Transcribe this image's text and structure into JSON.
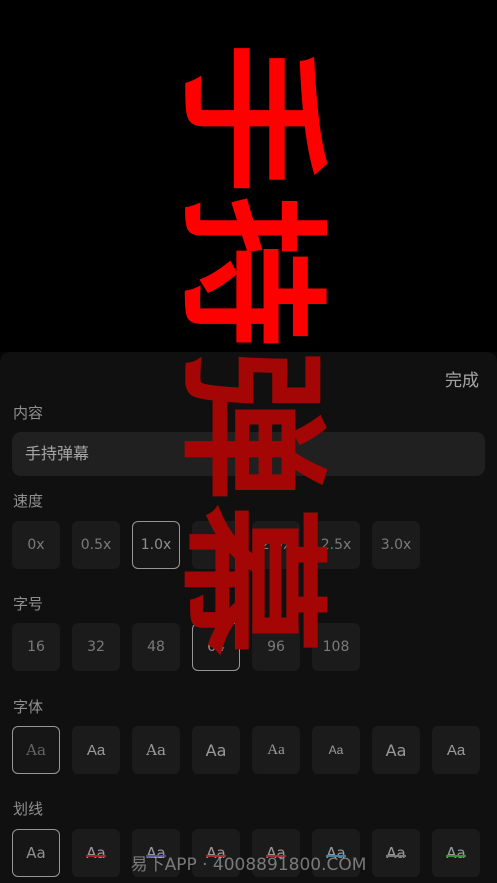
{
  "banner": {
    "chars": [
      "手",
      "持",
      "弹",
      "幕"
    ],
    "color": "#ff0000"
  },
  "header": {
    "done_label": "完成"
  },
  "content": {
    "label": "内容",
    "value": "手持弹幕"
  },
  "speed": {
    "label": "速度",
    "options": [
      "0x",
      "0.5x",
      "1.0x",
      "1.5x",
      "2.0x",
      "2.5x",
      "3.0x"
    ],
    "selected": "1.0x"
  },
  "size": {
    "label": "字号",
    "options": [
      "16",
      "32",
      "48",
      "64",
      "96",
      "108"
    ],
    "selected": "64"
  },
  "font": {
    "label": "字体",
    "sample": "Aa",
    "option_count": 8,
    "selected_index": 0
  },
  "stroke": {
    "label": "划线",
    "sample": "Aa",
    "colors": [
      "",
      "#ff3030",
      "#7777ff",
      "#ff4444",
      "#ff4040",
      "#5ec8ff",
      "#bbbbbb",
      "#55dd55"
    ],
    "selected_index": 0
  },
  "watermark": "易下APP · 4008891800.COM"
}
